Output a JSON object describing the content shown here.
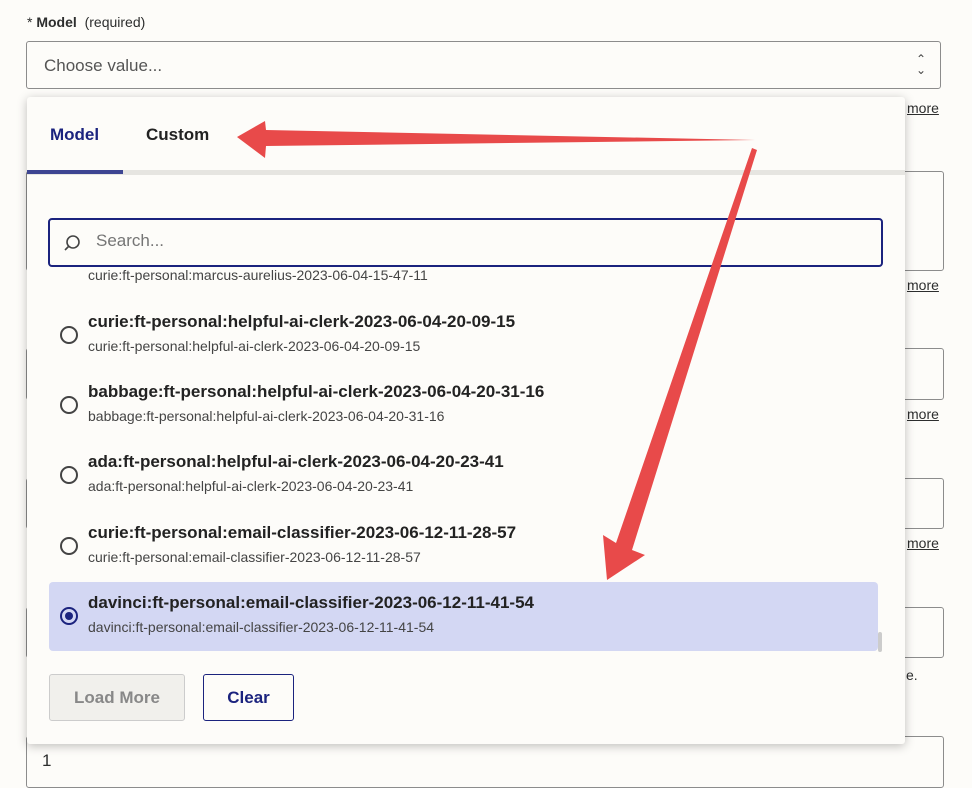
{
  "field": {
    "required_marker": "*",
    "label": "Model",
    "hint": "(required)",
    "placeholder": "Choose value..."
  },
  "background": {
    "more_links": [
      "more",
      "more",
      "more",
      "more"
    ],
    "fragment": "e.",
    "value": "1"
  },
  "dropdown": {
    "tabs": [
      {
        "label": "Model",
        "active": true
      },
      {
        "label": "Custom",
        "active": false
      }
    ],
    "search_placeholder": "Search...",
    "partial_item": "curie:ft-personal:marcus-aurelius-2023-06-04-15-47-11",
    "items": [
      {
        "title": "curie:ft-personal:helpful-ai-clerk-2023-06-04-20-09-15",
        "subtitle": "curie:ft-personal:helpful-ai-clerk-2023-06-04-20-09-15",
        "selected": false
      },
      {
        "title": "babbage:ft-personal:helpful-ai-clerk-2023-06-04-20-31-16",
        "subtitle": "babbage:ft-personal:helpful-ai-clerk-2023-06-04-20-31-16",
        "selected": false
      },
      {
        "title": "ada:ft-personal:helpful-ai-clerk-2023-06-04-20-23-41",
        "subtitle": "ada:ft-personal:helpful-ai-clerk-2023-06-04-20-23-41",
        "selected": false
      },
      {
        "title": "curie:ft-personal:email-classifier-2023-06-12-11-28-57",
        "subtitle": "curie:ft-personal:email-classifier-2023-06-12-11-28-57",
        "selected": false
      },
      {
        "title": "davinci:ft-personal:email-classifier-2023-06-12-11-41-54",
        "subtitle": "davinci:ft-personal:email-classifier-2023-06-12-11-41-54",
        "selected": true
      }
    ],
    "load_more_label": "Load More",
    "clear_label": "Clear"
  },
  "colors": {
    "accent": "#1b237e",
    "selected_bg": "#d3d7f3",
    "annotation_arrow": "#e84a4a"
  }
}
